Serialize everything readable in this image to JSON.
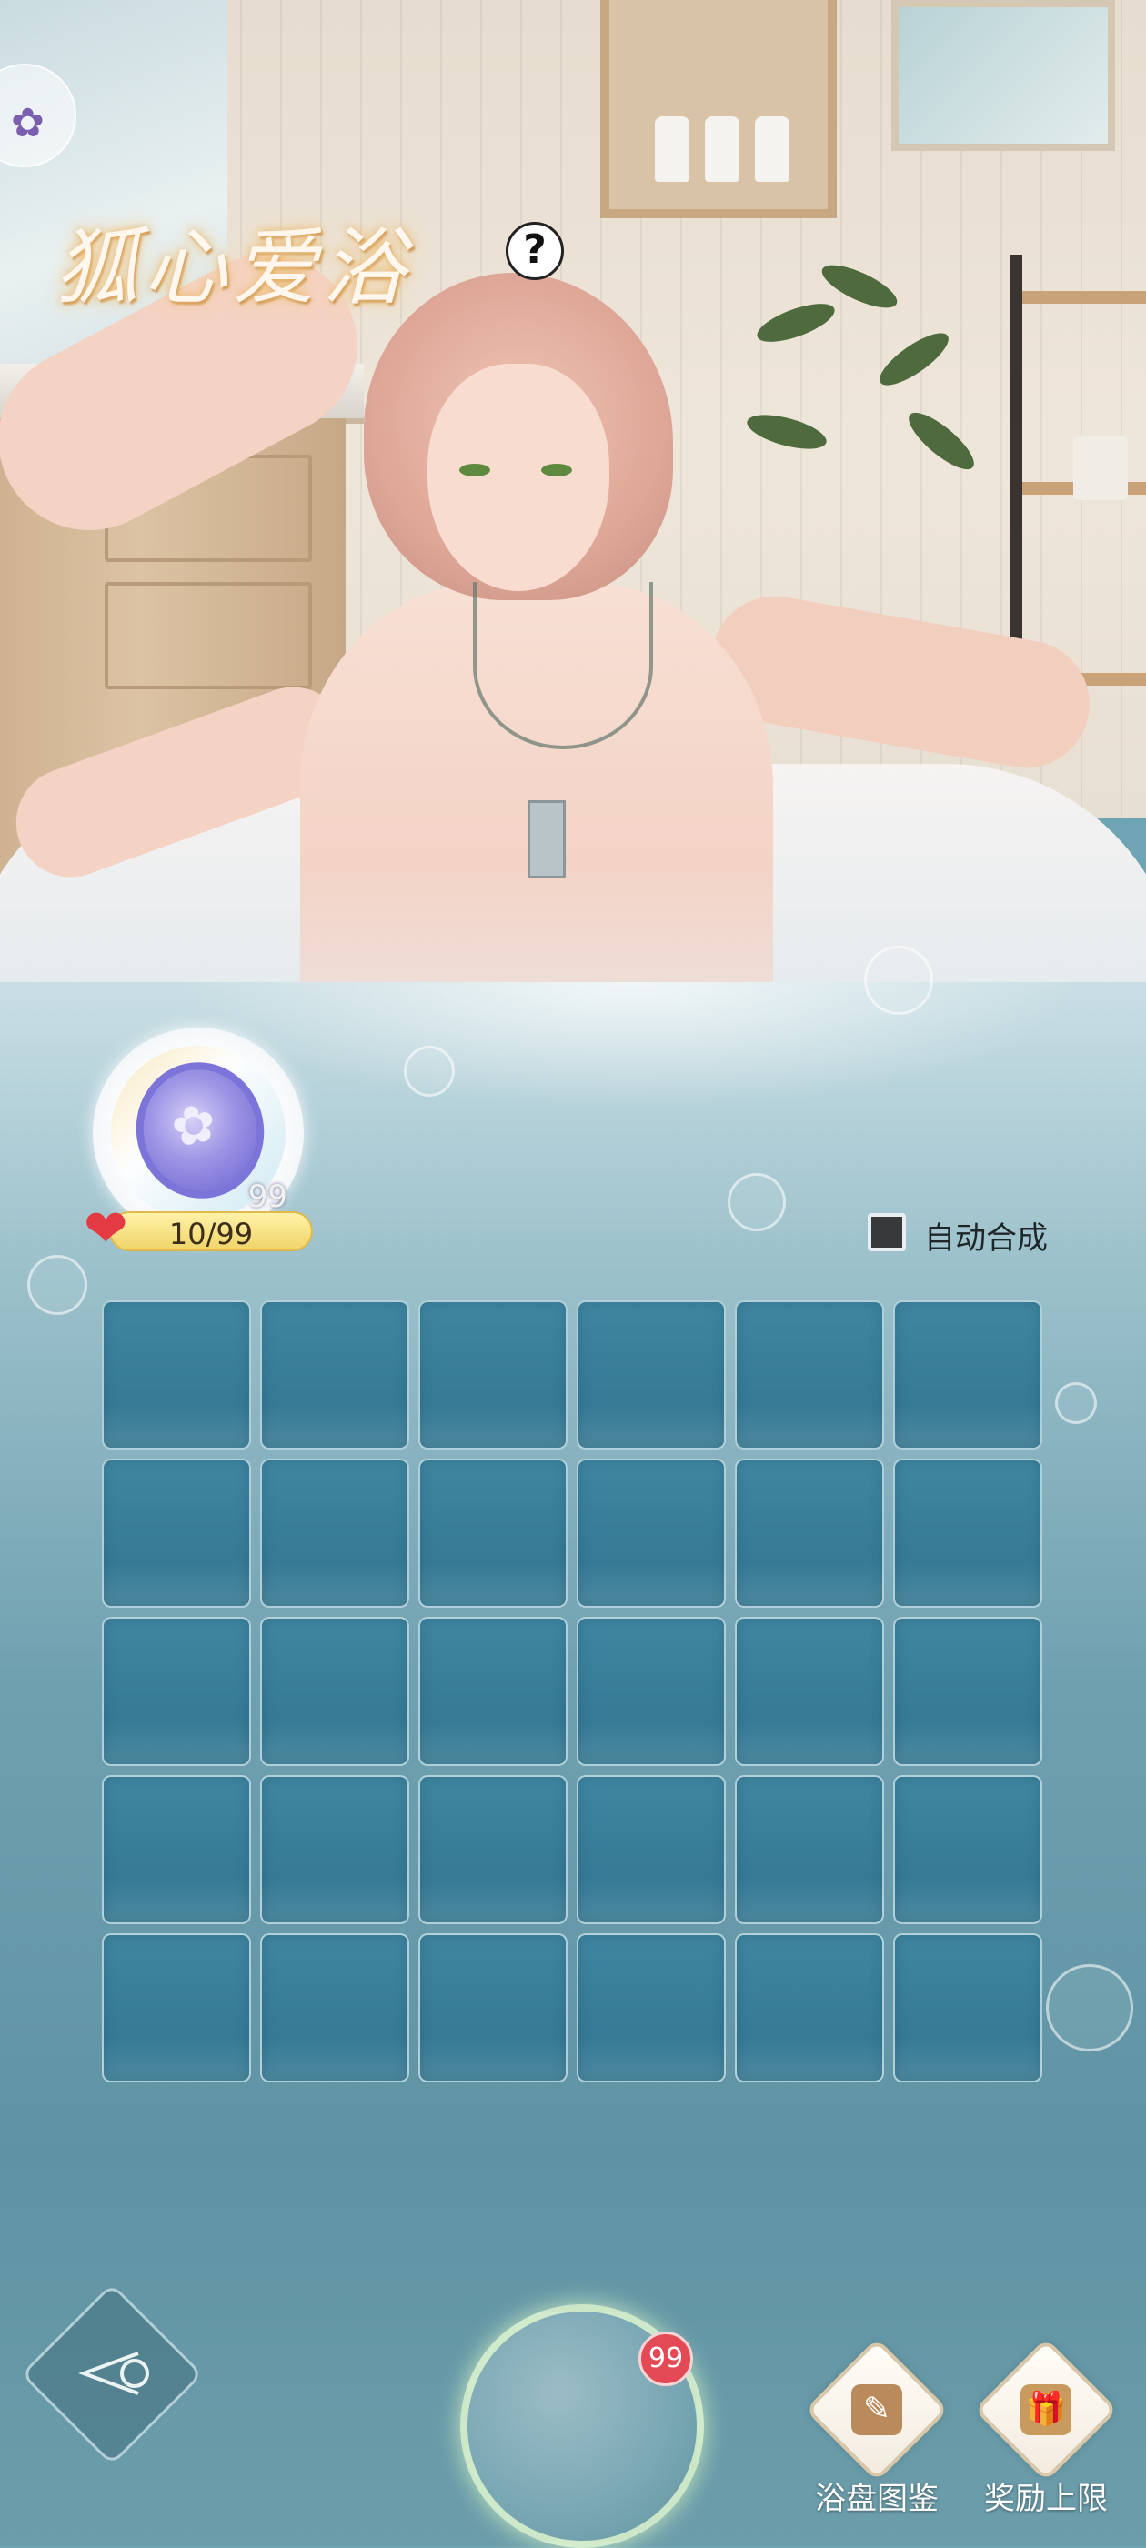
{
  "header": {
    "title": "狐心爱浴",
    "help_label": "?"
  },
  "token": {
    "count": "99",
    "icon": "bow-coin-icon"
  },
  "affection": {
    "value": "10/99",
    "icon": "heart-icon"
  },
  "auto_merge": {
    "label": "自动合成",
    "checked": false
  },
  "board": {
    "rows": 5,
    "columns": 6
  },
  "footer": {
    "bubble_badge": "99",
    "catalog_label": "浴盘图鉴",
    "reward_label": "奖励上限"
  },
  "colors": {
    "accent_heart": "#e43a43",
    "bar_fill": "#f1d46a",
    "cell_fill": "#3f86a1",
    "badge_red": "#e34a55"
  }
}
